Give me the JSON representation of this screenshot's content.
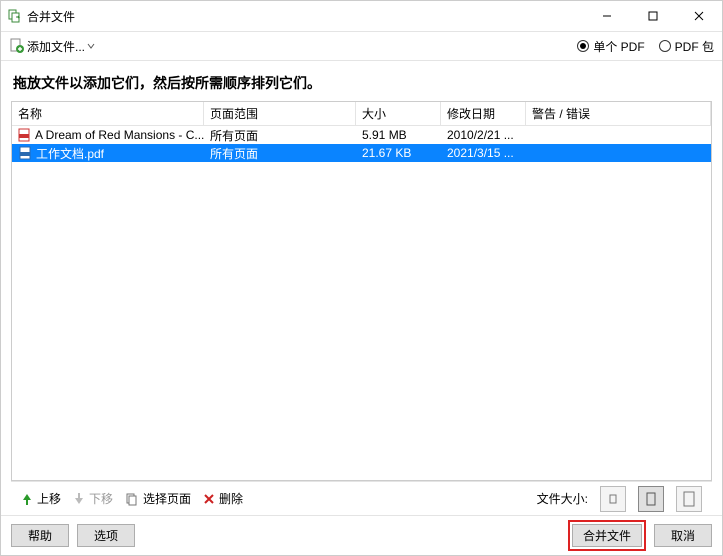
{
  "window_title": "合并文件",
  "toolbar": {
    "add_files_label": "添加文件...",
    "radio_single_pdf": "单个 PDF",
    "radio_pdf_pack": "PDF 包"
  },
  "instruction": "拖放文件以添加它们，然后按所需顺序排列它们。",
  "columns": {
    "name": "名称",
    "range": "页面范围",
    "size": "大小",
    "date": "修改日期",
    "warn": "警告 / 错误"
  },
  "rows": [
    {
      "name": "A Dream of Red Mansions - C...",
      "range": "所有页面",
      "size": "5.91 MB",
      "date": "2010/2/21 ..."
    },
    {
      "name": "工作文档.pdf",
      "range": "所有页面",
      "size": "21.67 KB",
      "date": "2021/3/15 ..."
    }
  ],
  "bottom": {
    "move_up": "上移",
    "move_down": "下移",
    "select_pages": "选择页面",
    "delete": "删除",
    "file_size_label": "文件大小:"
  },
  "footer": {
    "help": "帮助",
    "options": "选项",
    "merge": "合并文件",
    "cancel": "取消"
  }
}
